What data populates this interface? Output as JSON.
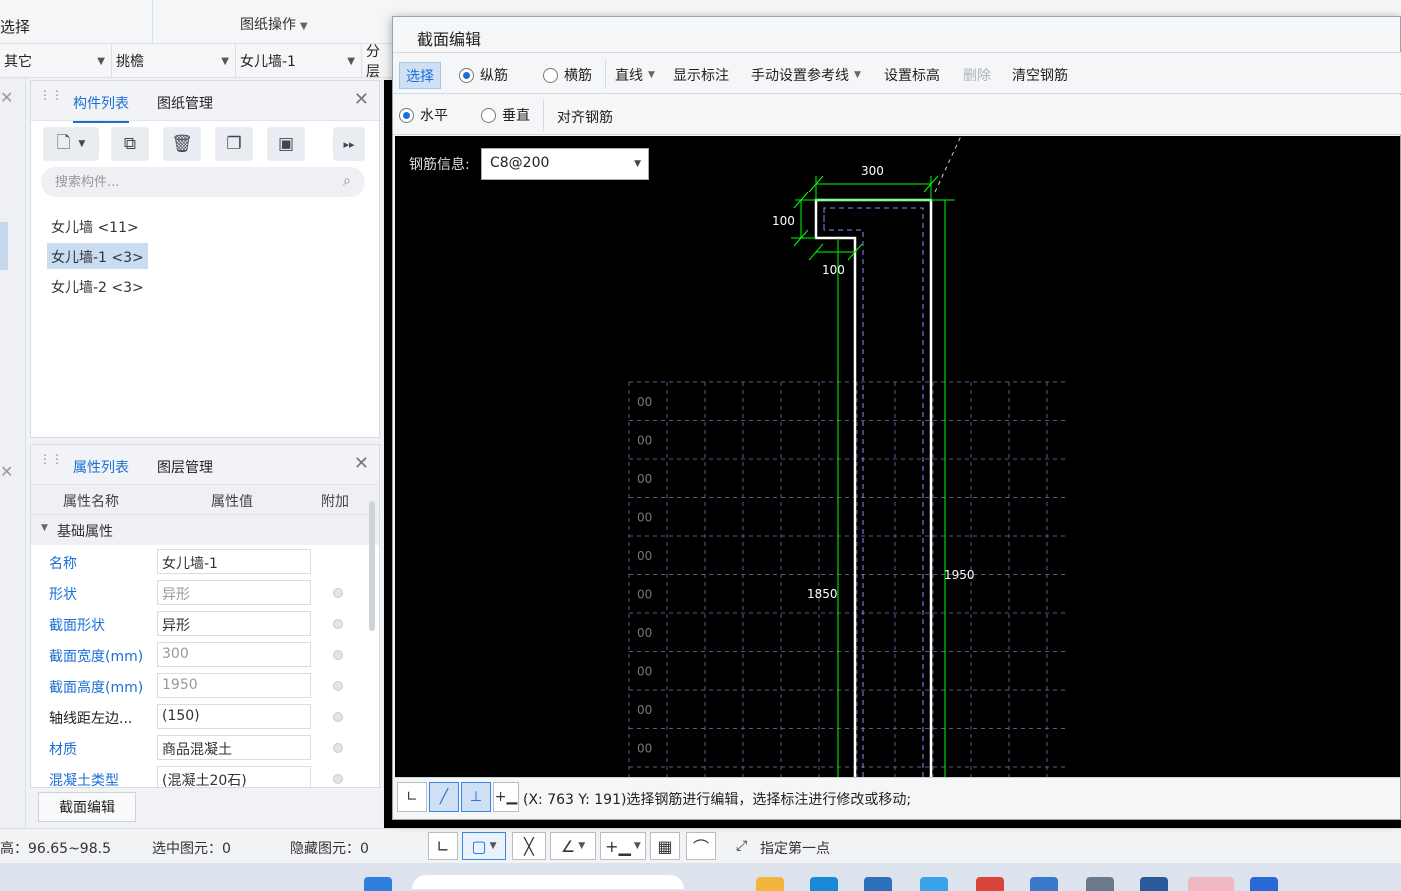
{
  "top": {
    "select_label": "选择",
    "drawing_ops": "图纸操作"
  },
  "filter_bar": {
    "category": "其它",
    "type": "挑檐",
    "element": "女儿墙-1",
    "layer": "分层"
  },
  "component_panel": {
    "tab_list": "构件列表",
    "tab_drawings": "图纸管理",
    "search_placeholder": "搜索构件...",
    "items": [
      {
        "label": "女儿墙 <11>"
      },
      {
        "label": "女儿墙-1 <3>"
      },
      {
        "label": "女儿墙-2 <3>"
      }
    ]
  },
  "property_panel": {
    "tab_props": "属性列表",
    "tab_layers": "图层管理",
    "col_name": "属性名称",
    "col_value": "属性值",
    "col_extra": "附加",
    "group_basic": "基础属性",
    "rows": [
      {
        "name": "名称",
        "value": "女儿墙-1"
      },
      {
        "name": "形状",
        "value": "异形"
      },
      {
        "name": "截面形状",
        "value": "异形"
      },
      {
        "name": "截面宽度(mm)",
        "value": "300"
      },
      {
        "name": "截面高度(mm)",
        "value": "1950"
      },
      {
        "name": "轴线距左边...",
        "value": "(150)"
      },
      {
        "name": "材质",
        "value": "商品混凝土"
      },
      {
        "name": "混凝土类型",
        "value": "(混凝土20石)"
      }
    ],
    "section_edit_button": "截面编辑"
  },
  "status_bar": {
    "elevation": "高：96.65~98.5",
    "selected": "选中图元：0",
    "hidden": "隐藏图元：0",
    "specify_point": "指定第一点"
  },
  "dialog": {
    "title": "截面编辑",
    "toolbar": {
      "select": "选择",
      "longitudinal": "纵筋",
      "transverse": "横筋",
      "line": "直线",
      "show_dims": "显示标注",
      "manual_ref": "手动设置参考线",
      "set_elevation": "设置标高",
      "delete": "删除",
      "clear_rebar": "清空钢筋"
    },
    "toolbar2": {
      "horizontal": "水平",
      "vertical": "垂直",
      "align_rebar": "对齐钢筋"
    },
    "rebar_info_label": "钢筋信息:",
    "rebar_info_value": "C8@200",
    "status_text": "(X: 763 Y: 191)选择钢筋进行编辑，选择标注进行修改或移动;"
  },
  "drawing": {
    "dim_top": "300",
    "dim_left": "100",
    "dim_bottom": "100",
    "dim_inner_height": "1850",
    "dim_outer_height": "1950",
    "grid_row_label": "00",
    "grid_row_count": 10,
    "colors": {
      "dim_line": "#00ff00",
      "section_outline": "#ffffff",
      "rebar_dash": "#8a8aff",
      "grid": "#5a5a8a"
    }
  }
}
